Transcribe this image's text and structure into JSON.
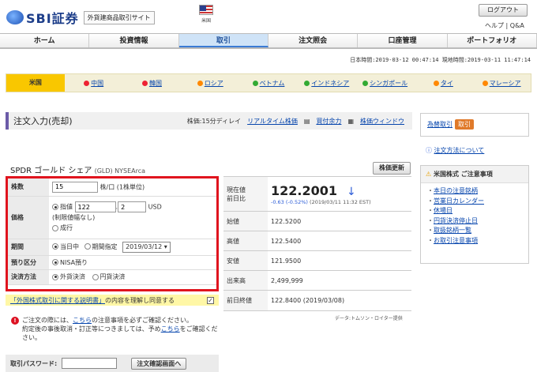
{
  "header": {
    "brand": "SBI証券",
    "site_label": "外貨建商品取引サイト",
    "flag_label": "米国",
    "logout": "ログアウト",
    "help": "ヘルプ",
    "separator": "|",
    "qa": "Q&A"
  },
  "nav": [
    "ホーム",
    "投資情報",
    "取引",
    "注文照会",
    "口座管理",
    "ポートフォリオ"
  ],
  "time": "日本時間:2019-03-12 00:47:14  現地時間:2019-03-11 11:47:14",
  "countries": [
    "米国",
    "中国",
    "韓国",
    "ロシア",
    "ベトナム",
    "インドネシア",
    "シンガポール",
    "タイ",
    "マレーシア"
  ],
  "order": {
    "title": "注文入力(売却)",
    "delay": "株価:15分ディレイ",
    "realtime": "リアルタイム株価",
    "buying_power": "買付余力",
    "window": "株価ウィンドウ"
  },
  "right": {
    "exchange": "為替取引",
    "exchange_btn": "取引",
    "howto": "注文方法について",
    "notice_title": "米国株式 ご注意事項",
    "notice_items": [
      "本日の注意銘柄",
      "営業日カレンダー",
      "休場日",
      "円貨決済停止日",
      "取扱銘柄一覧",
      "お取引注意事項"
    ]
  },
  "stock": {
    "name": "SPDR ゴールド シェア",
    "code": "(GLD) NYSEArca",
    "button": "株価更新"
  },
  "form": {
    "qty_label": "株数",
    "qty_value": "15",
    "qty_unit": "株/口 (1株単位)",
    "price_label": "価格",
    "limit": "指値",
    "price_int": "122",
    "price_dec": "2",
    "currency": "USD",
    "range_note": "(制限値幅なし)",
    "market": "成行",
    "term_label": "期間",
    "today": "当日中",
    "term_specify": "期間指定",
    "term_date": "2019/03/12",
    "custody_label": "預り区分",
    "custody": "NISA預り",
    "settle_label": "決済方法",
    "settle_fx": "外貨決済",
    "settle_jpy": "円貨決済"
  },
  "quote": {
    "current_label": "現在値",
    "prev_label": "前日比",
    "current": "122.2001",
    "change": "-0.63 (-0.52%)",
    "change_time": "(2019/03/11 11:32 EST)",
    "rows": [
      {
        "label": "始値",
        "value": "122.5200"
      },
      {
        "label": "高値",
        "value": "122.5400"
      },
      {
        "label": "安値",
        "value": "121.9500"
      },
      {
        "label": "出来高",
        "value": "2,499,999"
      },
      {
        "label": "前日終値",
        "value": "122.8400 (2019/03/08)"
      }
    ],
    "source": "データ:トムソン・ロイター提供"
  },
  "agree": {
    "link": "「外国株式取引に関する説明書」",
    "text": "の内容を理解し同意する"
  },
  "warning": {
    "line1a": "ご注文の際には、",
    "link1": "こちら",
    "line1b": "の注意事項を必ずご確認ください。",
    "line2a": "約定後の事後取消・訂正等につきましては、予め",
    "link2": "こちら",
    "line2b": "をご確認ください。"
  },
  "password": {
    "label": "取引パスワード:",
    "button": "注文確認画面へ"
  },
  "colors": {
    "accent": "#e0141e",
    "country_active": "#f9c700",
    "nav_active": "#cfe3f7"
  }
}
